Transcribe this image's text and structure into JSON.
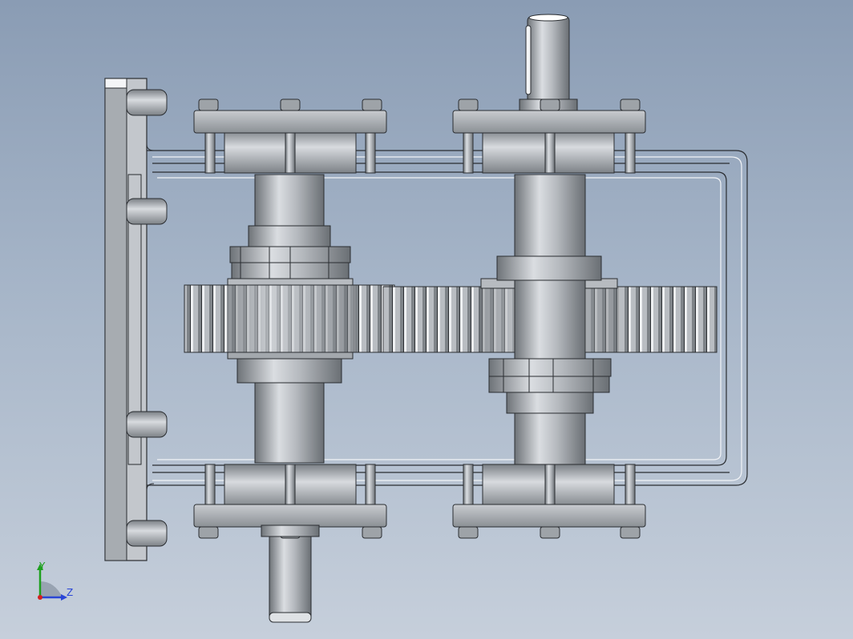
{
  "viewport": {
    "background_top": "#8a9cb4",
    "background_bottom": "#c6cfdb",
    "description_colors": {
      "metal_light": "#d6d9dd",
      "metal_mid": "#a9adb2",
      "metal_dark": "#6e7378",
      "edge": "#2a2d31",
      "housing_line": "#f2f4f7"
    }
  },
  "triad": {
    "y_label": "Y",
    "z_label": "Z",
    "y_color": "#1ea01e",
    "z_color": "#2a46d6",
    "origin_color": "#d42020"
  }
}
